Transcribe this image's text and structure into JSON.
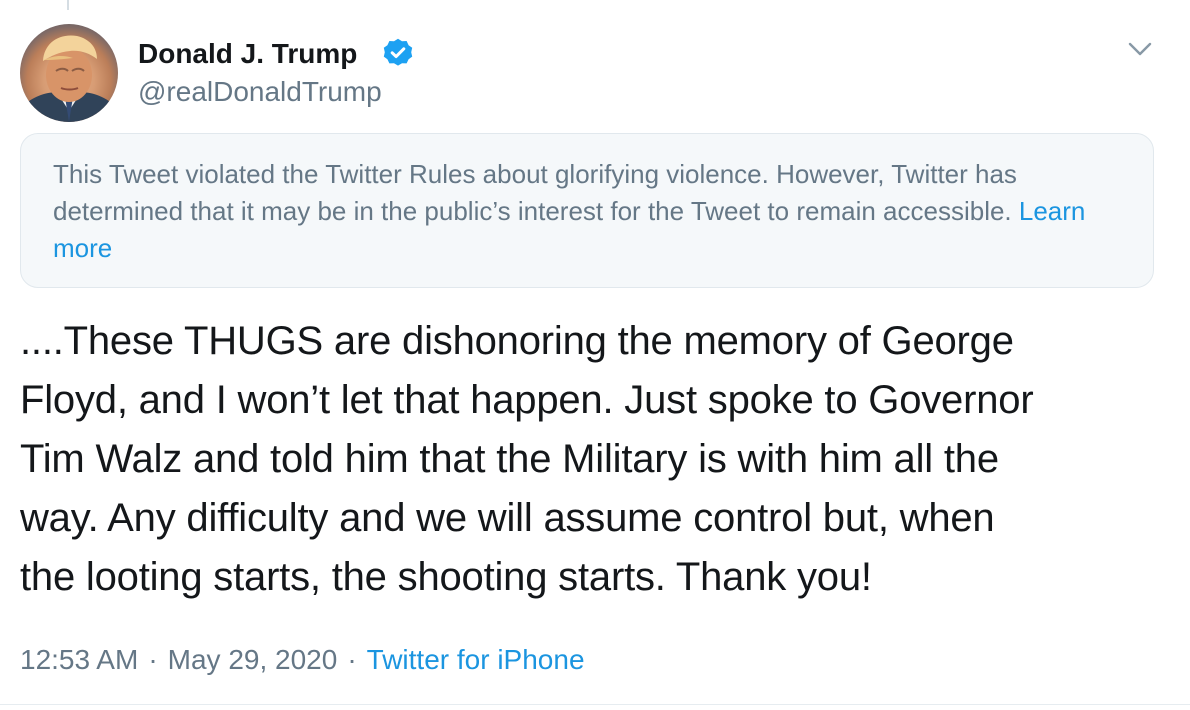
{
  "tweet": {
    "author": {
      "name": "Donald J. Trump",
      "handle": "@realDonaldTrump",
      "verified_icon": "verified-badge-icon"
    },
    "menu_icon": "chevron-down-icon",
    "notice": {
      "text": "This Tweet violated the Twitter Rules about glorifying violence. However, Twitter has determined that it may be in the public’s interest for the Tweet to remain accessible.",
      "link_text": "Learn more"
    },
    "body_lines": [
      "....These THUGS are dishonoring the memory of George",
      "Floyd, and I won’t let that happen. Just spoke to Governor",
      "Tim Walz and told him that the Military is with him all the",
      "way. Any difficulty and we will assume control but, when",
      "the looting starts, the shooting starts. Thank you!"
    ],
    "timestamp": "12:53 AM",
    "date": "May 29, 2020",
    "separator": "·",
    "source": "Twitter for iPhone"
  },
  "colors": {
    "text": "#14171a",
    "secondary_text": "#657786",
    "link": "#1b95e0",
    "verified": "#1da1f2",
    "notice_bg": "#f5f8fa",
    "border": "#e1e8ed"
  }
}
